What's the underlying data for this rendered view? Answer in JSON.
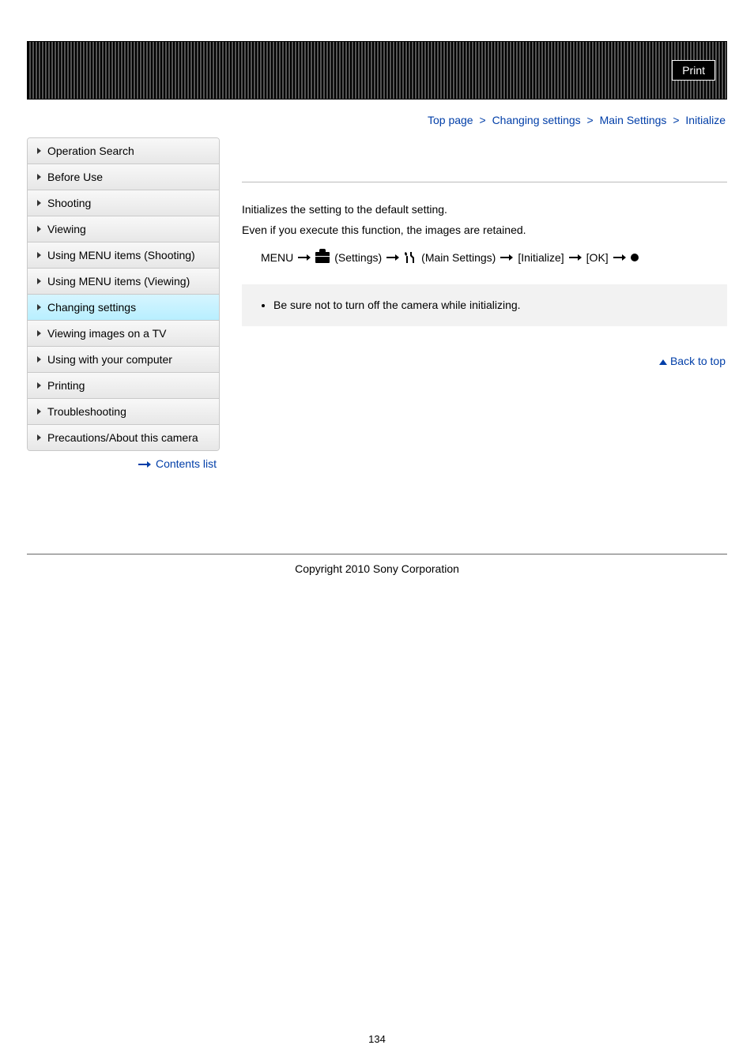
{
  "banner": {
    "print_label": "Print"
  },
  "breadcrumb": {
    "items": [
      "Top page",
      "Changing settings",
      "Main Settings",
      "Initialize"
    ],
    "sep": ">"
  },
  "sidebar": {
    "items": [
      {
        "label": "Operation Search"
      },
      {
        "label": "Before Use"
      },
      {
        "label": "Shooting"
      },
      {
        "label": "Viewing"
      },
      {
        "label": "Using MENU items (Shooting)"
      },
      {
        "label": "Using MENU items (Viewing)"
      },
      {
        "label": "Changing settings",
        "active": true
      },
      {
        "label": "Viewing images on a TV"
      },
      {
        "label": "Using with your computer"
      },
      {
        "label": "Printing"
      },
      {
        "label": "Troubleshooting"
      },
      {
        "label": "Precautions/About this camera"
      }
    ],
    "contents_link": "Contents list"
  },
  "main": {
    "para1": "Initializes the setting to the default setting.",
    "para2": "Even if you execute this function, the images are retained.",
    "path": {
      "menu": "MENU",
      "settings": "(Settings)",
      "main_settings": "(Main Settings)",
      "initialize": "[Initialize]",
      "ok": "[OK]"
    },
    "note": "Be sure not to turn off the camera while initializing.",
    "back_to_top": "Back to top"
  },
  "footer": {
    "copyright": "Copyright 2010 Sony Corporation",
    "page": "134"
  }
}
